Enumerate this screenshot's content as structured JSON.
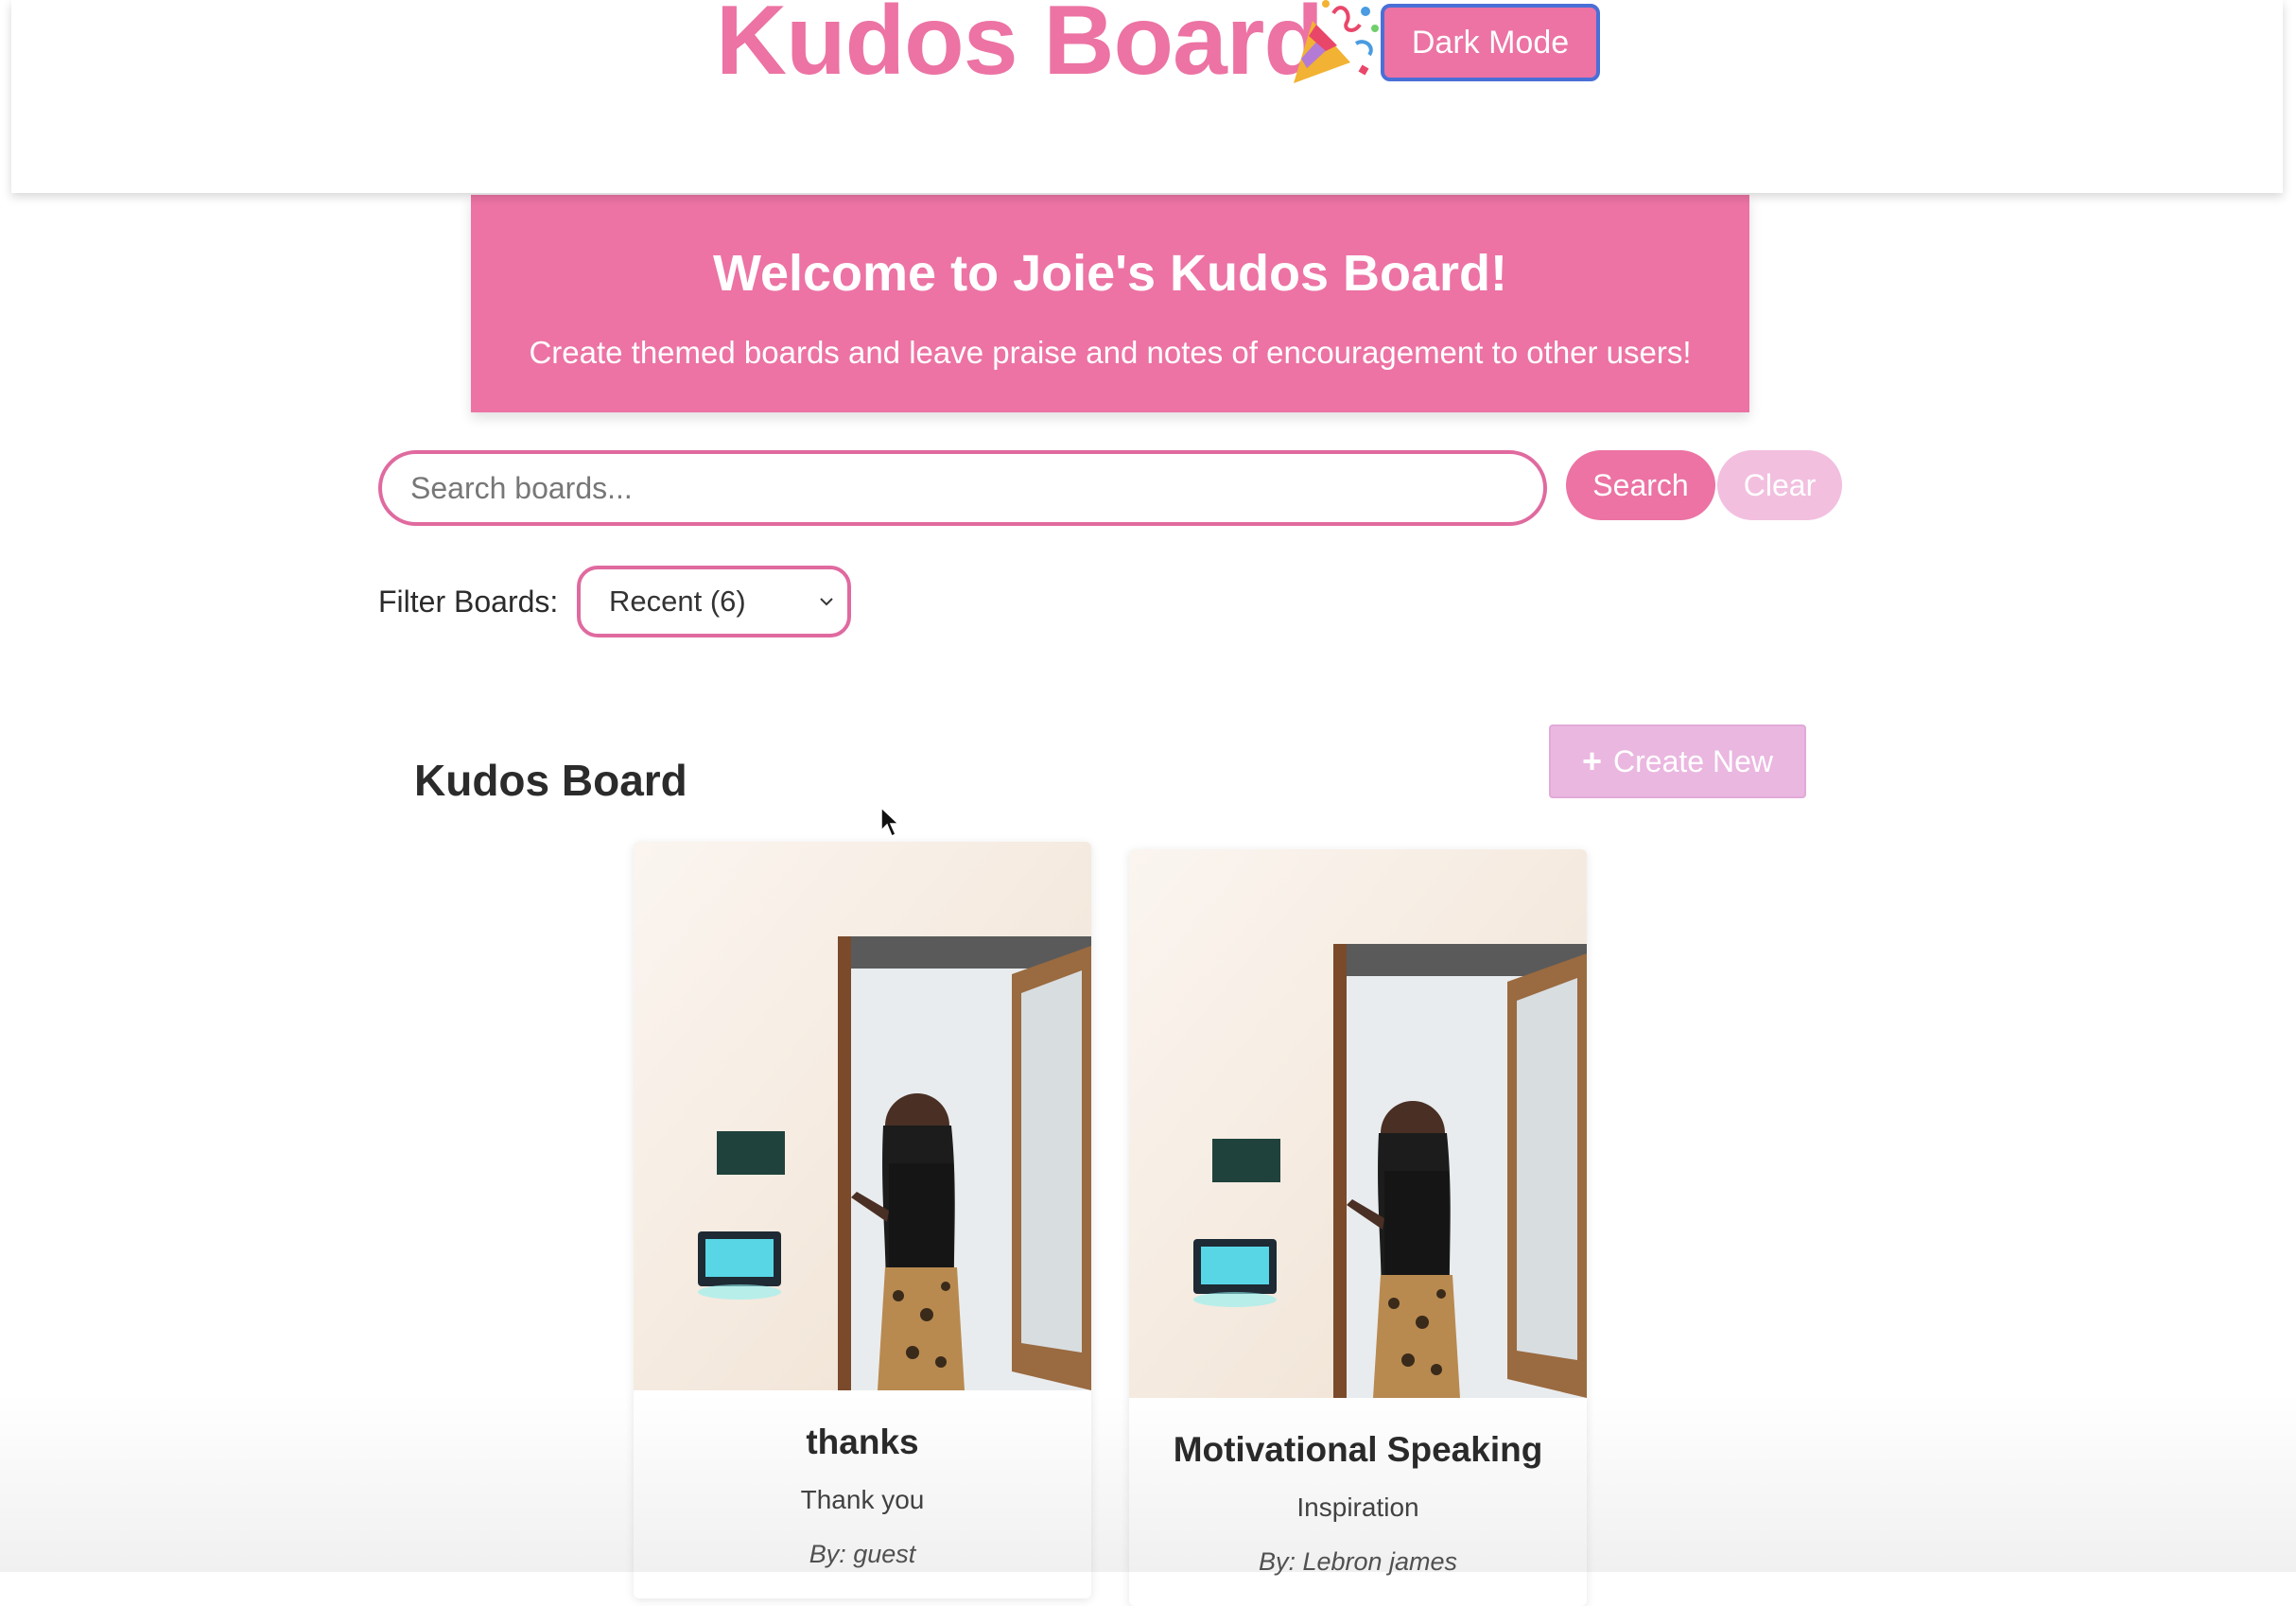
{
  "header": {
    "title": "Kudos Board",
    "party_icon": "party-popper-icon",
    "dark_mode_label": "Dark Mode"
  },
  "banner": {
    "title": "Welcome to Joie's Kudos Board!",
    "subtitle": "Create themed boards and leave praise and notes of encouragement to other users!"
  },
  "search": {
    "placeholder": "Search boards...",
    "value": "",
    "search_label": "Search",
    "clear_label": "Clear"
  },
  "filter": {
    "label": "Filter Boards:",
    "selected": "Recent (6)"
  },
  "section": {
    "title": "Kudos Board",
    "create_label": "Create New",
    "create_icon": "plus-icon"
  },
  "cards": [
    {
      "title": "thanks",
      "category": "Thank you",
      "author": "By: guest"
    },
    {
      "title": "Motivational Speaking",
      "category": "Inspiration",
      "author": "By: Lebron james"
    }
  ],
  "colors": {
    "accent": "#ec73a4",
    "clear_button": "#f2bfdf",
    "create_button": "#eab7e0",
    "dark_mode_border": "#4a6fd6"
  }
}
